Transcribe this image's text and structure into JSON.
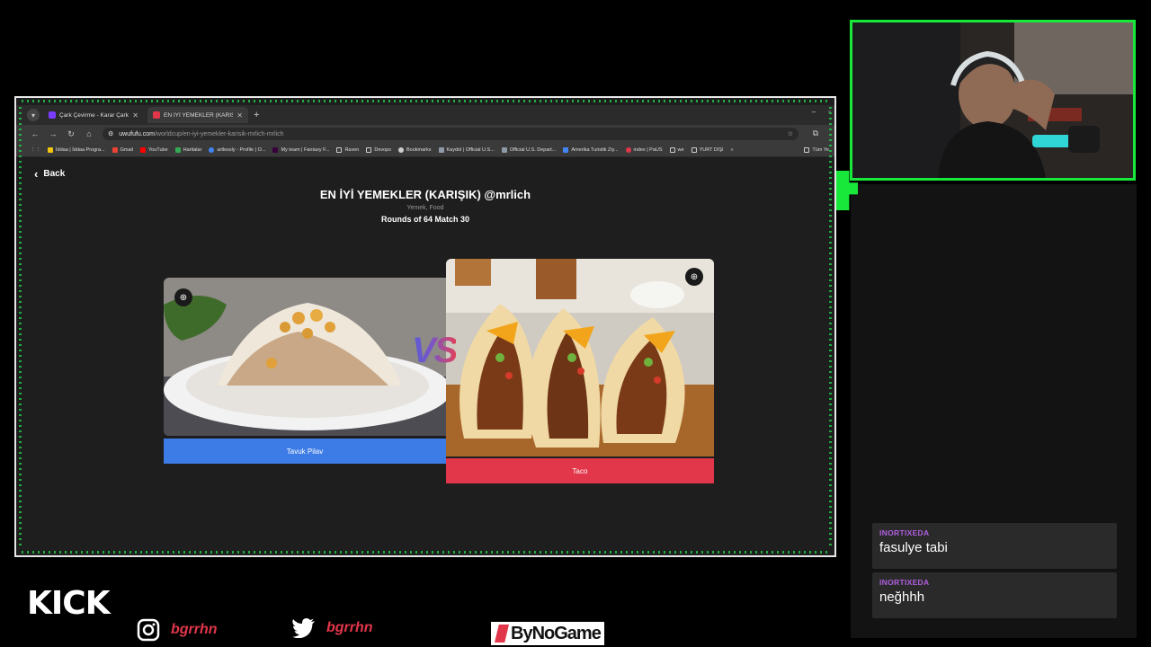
{
  "browser": {
    "tabs": [
      {
        "title": "Çark Çevirme - Karar Çarkı!",
        "favicon_color": "#7a3cff"
      },
      {
        "title": "EN İYİ YEMEKLER (KARIŞIK) @m",
        "favicon_color": "#e2364a"
      }
    ],
    "url_domain": "uwufufu.com",
    "url_path": "/worldcup/en-iyi-yemekler-karisik-mrlich-mrlich",
    "bookmarks": [
      "İddaa | İddaa Progra...",
      "Gmail",
      "YouTube",
      "Haritalar",
      "artlessly - Profile | O...",
      "My team | Fantasy F...",
      "Raven",
      "Devops",
      "Bookmarks",
      "Kaydol | Official U.S...",
      "Official U.S. Depart...",
      "Amerika Turistik Ziy...",
      "index | PaUS",
      "we",
      "YURT DIŞI"
    ],
    "bookmarks_more": "»",
    "bookmarks_all": "Tüm Ye"
  },
  "page": {
    "back_label": "Back",
    "title": "EN İYİ YEMEKLER (KARIŞIK) @mrlich",
    "subtitle": "Yemek, Food",
    "rounds": "Rounds of 64 Match 30",
    "vs": "VS",
    "left_choice": "Tavuk Pilav",
    "right_choice": "Taco"
  },
  "chat": [
    {
      "user": "INORTIXEDA",
      "message": "fasulye tabi"
    },
    {
      "user": "INORTIXEDA",
      "message": "neğhhh"
    }
  ],
  "overlay": {
    "kick": "KICK",
    "instagram": "bgrrhn",
    "twitter": "bgrrhn",
    "sponsor": "ByNoGame"
  },
  "colors": {
    "accent_green": "#18e83a",
    "blue_button": "#3d7be6",
    "red_button": "#e2364a",
    "chat_user": "#b15ee0"
  }
}
